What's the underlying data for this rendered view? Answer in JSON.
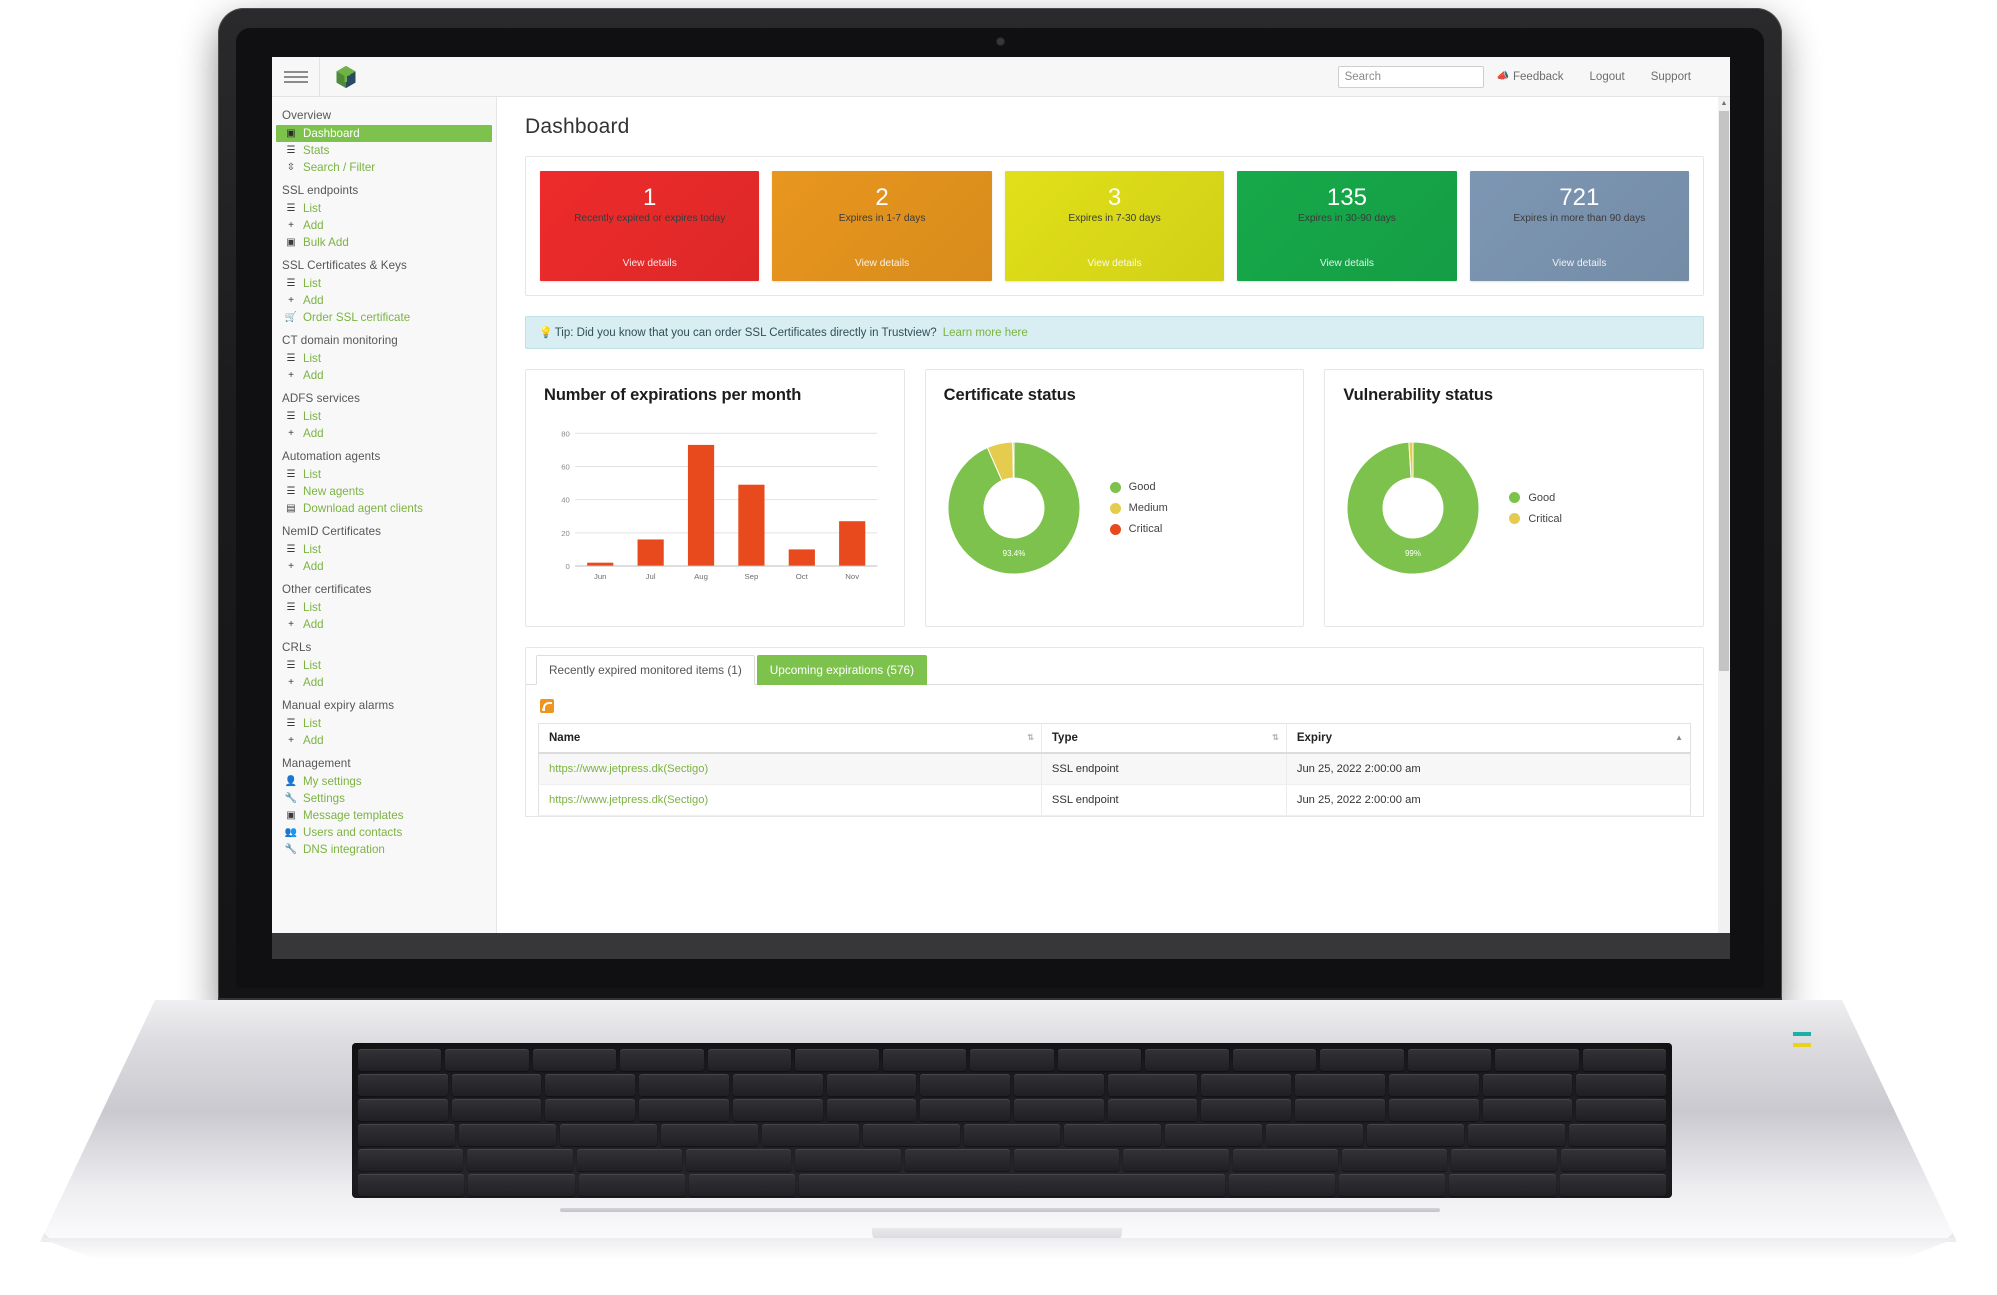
{
  "app": {
    "logo_name": "trustview-logo",
    "page_title": "Dashboard"
  },
  "topbar": {
    "menu_icon": "hamburger-icon",
    "search_placeholder": "Search",
    "search_value": "",
    "feedback_label": "Feedback",
    "feedback_icon": "megaphone-icon",
    "logout_label": "Logout",
    "support_label": "Support"
  },
  "sidebar": {
    "groups": [
      {
        "title": "Overview",
        "items": [
          {
            "label": "Dashboard",
            "icon": "dashboard-icon",
            "active": true
          },
          {
            "label": "Stats",
            "icon": "list-icon",
            "active": false
          },
          {
            "label": "Search / Filter",
            "icon": "filter-icon",
            "active": false
          }
        ]
      },
      {
        "title": "SSL endpoints",
        "items": [
          {
            "label": "List",
            "icon": "list-icon",
            "active": false
          },
          {
            "label": "Add",
            "icon": "plus-icon",
            "active": false
          },
          {
            "label": "Bulk Add",
            "icon": "bulk-add-icon",
            "active": false
          }
        ]
      },
      {
        "title": "SSL Certificates & Keys",
        "items": [
          {
            "label": "List",
            "icon": "list-icon",
            "active": false
          },
          {
            "label": "Add",
            "icon": "plus-icon",
            "active": false
          },
          {
            "label": "Order SSL certificate",
            "icon": "cart-icon",
            "active": false
          }
        ]
      },
      {
        "title": "CT domain monitoring",
        "items": [
          {
            "label": "List",
            "icon": "list-icon",
            "active": false
          },
          {
            "label": "Add",
            "icon": "plus-icon",
            "active": false
          }
        ]
      },
      {
        "title": "ADFS services",
        "items": [
          {
            "label": "List",
            "icon": "list-icon",
            "active": false
          },
          {
            "label": "Add",
            "icon": "plus-icon",
            "active": false
          }
        ]
      },
      {
        "title": "Automation agents",
        "items": [
          {
            "label": "List",
            "icon": "list-icon",
            "active": false
          },
          {
            "label": "New agents",
            "icon": "list-icon",
            "active": false
          },
          {
            "label": "Download agent clients",
            "icon": "download-file-icon",
            "active": false
          }
        ]
      },
      {
        "title": "NemID Certificates",
        "items": [
          {
            "label": "List",
            "icon": "list-icon",
            "active": false
          },
          {
            "label": "Add",
            "icon": "plus-icon",
            "active": false
          }
        ]
      },
      {
        "title": "Other certificates",
        "items": [
          {
            "label": "List",
            "icon": "list-icon",
            "active": false
          },
          {
            "label": "Add",
            "icon": "plus-icon",
            "active": false
          }
        ]
      },
      {
        "title": "CRLs",
        "items": [
          {
            "label": "List",
            "icon": "list-icon",
            "active": false
          },
          {
            "label": "Add",
            "icon": "plus-icon",
            "active": false
          }
        ]
      },
      {
        "title": "Manual expiry alarms",
        "items": [
          {
            "label": "List",
            "icon": "list-icon",
            "active": false
          },
          {
            "label": "Add",
            "icon": "plus-icon",
            "active": false
          }
        ]
      },
      {
        "title": "Management",
        "items": [
          {
            "label": "My settings",
            "icon": "user-settings-icon",
            "active": false
          },
          {
            "label": "Settings",
            "icon": "wrench-icon",
            "active": false
          },
          {
            "label": "Message templates",
            "icon": "message-icon",
            "active": false
          },
          {
            "label": "Users and contacts",
            "icon": "users-icon",
            "active": false
          },
          {
            "label": "DNS integration",
            "icon": "wrench-icon",
            "active": false
          }
        ]
      }
    ]
  },
  "kpis": [
    {
      "value": "1",
      "label": "Recently expired or expires today",
      "link": "View details",
      "color": "#ee2b2b"
    },
    {
      "value": "2",
      "label": "Expires in 1-7 days",
      "link": "View details",
      "color": "#e8961e"
    },
    {
      "value": "3",
      "label": "Expires in 7-30 days",
      "link": "View details",
      "color": "#e1e019"
    },
    {
      "value": "135",
      "label": "Expires in 30-90 days",
      "link": "View details",
      "color": "#17a94a"
    },
    {
      "value": "721",
      "label": "Expires in more than 90 days",
      "link": "View details",
      "color": "#7d96b3"
    }
  ],
  "tip": {
    "icon": "lightbulb-icon",
    "text": "Tip: Did you know that you can order SSL Certificates directly in Trustview?",
    "link_label": "Learn more here"
  },
  "chart_data": [
    {
      "type": "bar",
      "title": "Number of expirations per month",
      "categories": [
        "Jun",
        "Jul",
        "Aug",
        "Sep",
        "Oct",
        "Nov"
      ],
      "values": [
        2,
        16,
        73,
        49,
        10,
        27
      ],
      "xlabel": "",
      "ylabel": "",
      "ylim": [
        0,
        85
      ],
      "yticks": [
        0,
        20,
        40,
        60,
        80
      ],
      "grid": true,
      "legend": "none",
      "bar_color": "#e8491d"
    },
    {
      "type": "pie",
      "title": "Certificate status",
      "labels": [
        "Good",
        "Medium",
        "Critical"
      ],
      "values": [
        93.4,
        6.3,
        0.3
      ],
      "colors": [
        "#7cc24c",
        "#e5cc4f",
        "#e8491d"
      ],
      "center_label": "93.4%",
      "legend": "right",
      "donut": true
    },
    {
      "type": "pie",
      "title": "Vulnerability status",
      "labels": [
        "Good",
        "Critical"
      ],
      "values": [
        99,
        1
      ],
      "colors": [
        "#7cc24c",
        "#e5cc4f"
      ],
      "center_label": "99%",
      "legend": "right",
      "donut": true
    }
  ],
  "tabs": [
    {
      "label": "Recently expired monitored items (1)",
      "active": false
    },
    {
      "label": "Upcoming expirations (576)",
      "active": true
    }
  ],
  "table": {
    "rss_icon": "rss-feed-icon",
    "columns": [
      {
        "label": "Name",
        "sort": "none"
      },
      {
        "label": "Type",
        "sort": "none"
      },
      {
        "label": "Expiry",
        "sort": "asc"
      }
    ],
    "rows": [
      {
        "name": "https://www.jetpress.dk(Sectigo)",
        "type": "SSL endpoint",
        "expiry": "Jun 25, 2022 2:00:00 am"
      },
      {
        "name": "https://www.jetpress.dk(Sectigo)",
        "type": "SSL endpoint",
        "expiry": "Jun 25, 2022 2:00:00 am"
      }
    ]
  },
  "scrollbar": {
    "up_arrow": "chevron-up-icon",
    "down_arrow": "chevron-down-icon"
  }
}
